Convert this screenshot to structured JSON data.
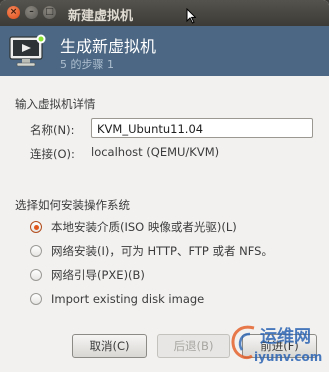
{
  "window": {
    "title": "新建虚拟机",
    "close_glyph": "×",
    "min_glyph": "–",
    "max_glyph": "□"
  },
  "banner": {
    "icon": "monitor-icon",
    "title": "生成新虚拟机",
    "step": "5 的步骤 1"
  },
  "details": {
    "heading": "输入虚拟机详情",
    "name_label": "名称(N):",
    "name_value": "KVM_Ubuntu11.04",
    "connection_label": "连接(O):",
    "connection_value": "localhost (QEMU/KVM)"
  },
  "install": {
    "heading": "选择如何安装操作系统",
    "options": [
      {
        "label": "本地安装介质(ISO 映像或者光驱)(L)",
        "checked": true
      },
      {
        "label": "网络安装(I)，可为 HTTP、FTP 或者 NFS。",
        "checked": false
      },
      {
        "label": "网络引导(PXE)(B)",
        "checked": false
      },
      {
        "label": "Import existing disk image",
        "checked": false
      }
    ]
  },
  "buttons": {
    "cancel": "取消(C)",
    "back": "后退(B)",
    "forward": "前进(F)"
  },
  "watermark": {
    "text_cn": "运维网",
    "text_en": "iyunv.com"
  },
  "colors": {
    "banner": "#4b6783",
    "radio_selected": "#e2581c",
    "titlebar": "#3c3b37"
  }
}
